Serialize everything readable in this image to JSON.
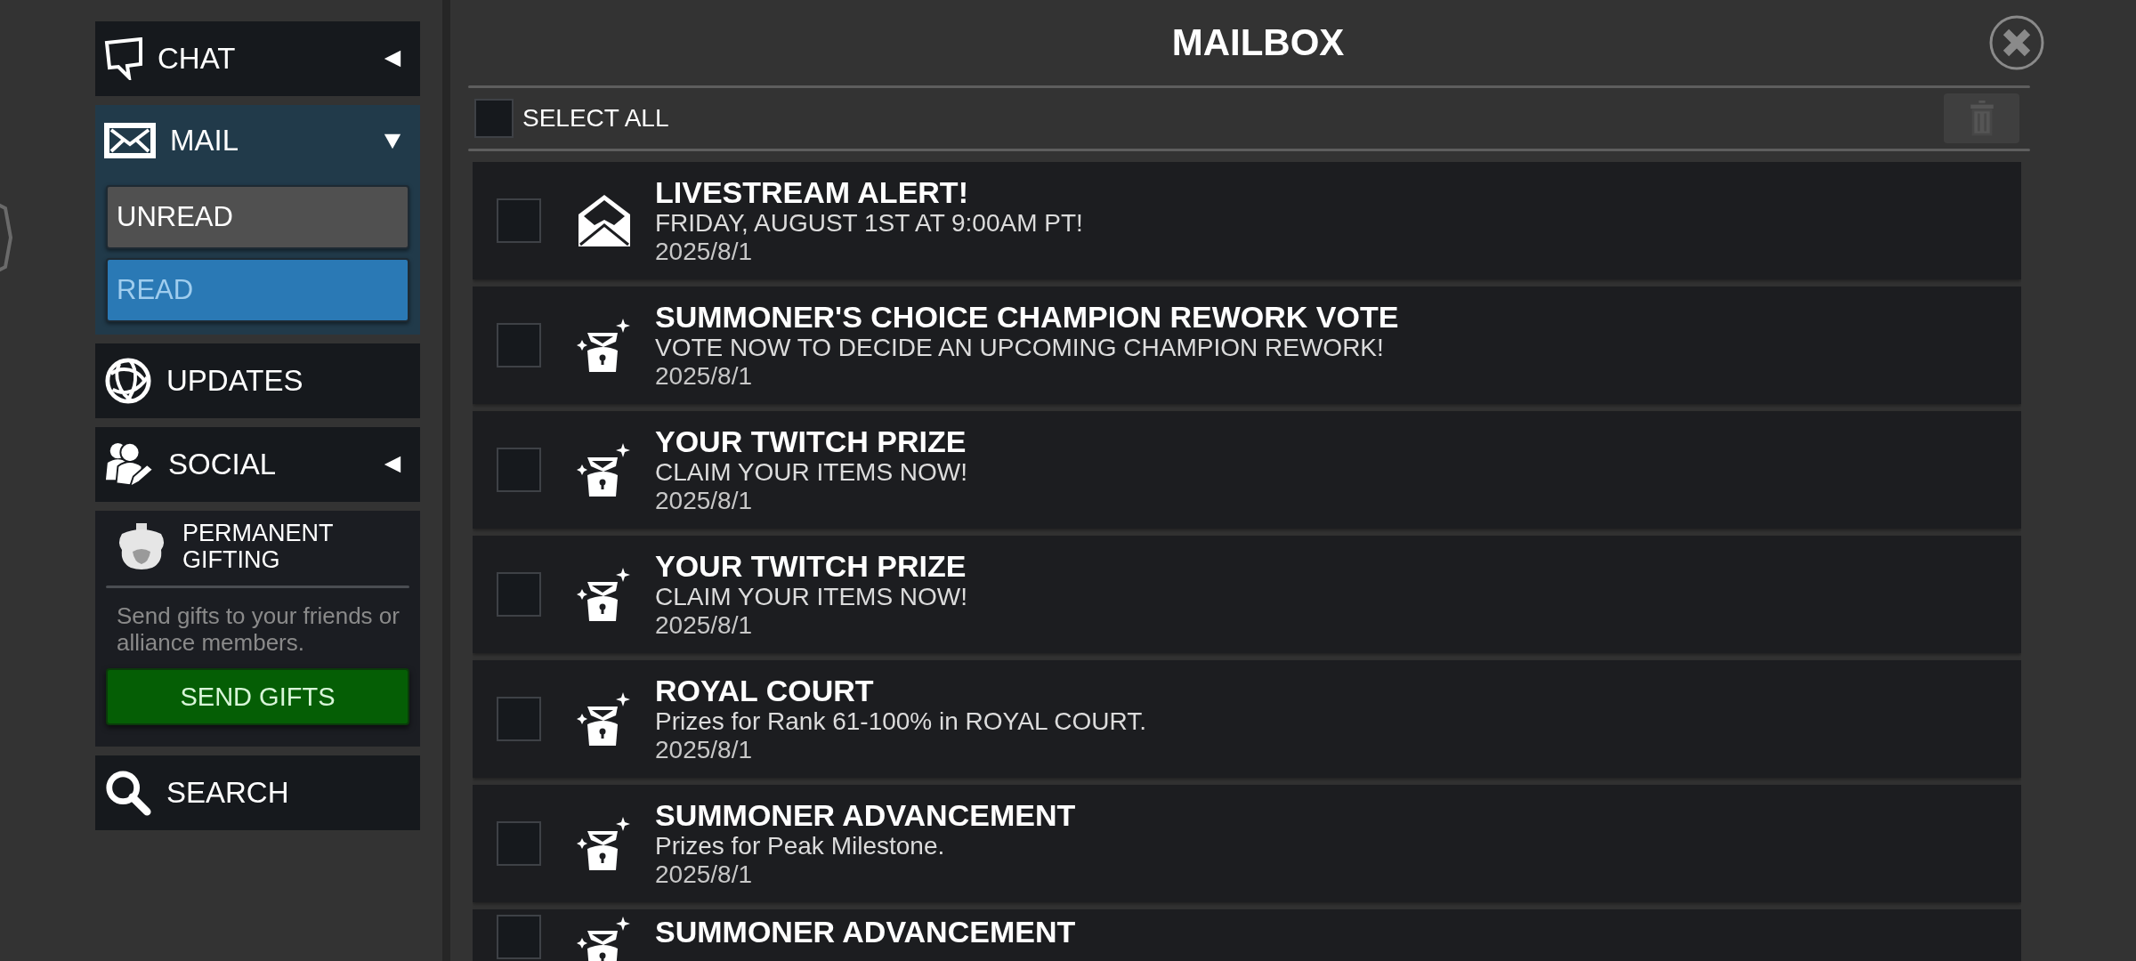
{
  "sidebar": {
    "chat": {
      "label": "CHAT",
      "expanded": false
    },
    "mail": {
      "label": "MAIL",
      "expanded": true,
      "filters": [
        {
          "label": "UNREAD",
          "selected": false
        },
        {
          "label": "READ",
          "selected": true
        }
      ]
    },
    "updates": {
      "label": "UPDATES"
    },
    "social": {
      "label": "SOCIAL",
      "expanded": false
    },
    "gifting": {
      "title": "PERMANENT GIFTING",
      "description": "Send gifts to your friends or alliance members.",
      "button": "SEND GIFTS"
    },
    "search": {
      "label": "SEARCH"
    }
  },
  "mailbox": {
    "title": "MAILBOX",
    "select_all": {
      "label": "SELECT ALL",
      "checked": false
    },
    "messages": [
      {
        "kind": "notice",
        "title": "LIVESTREAM ALERT!",
        "subtitle": "FRIDAY, AUGUST 1ST AT 9:00AM PT!",
        "date": "2025/8/1",
        "checked": false
      },
      {
        "kind": "reward",
        "title": "SUMMONER'S CHOICE CHAMPION REWORK VOTE",
        "subtitle": "VOTE NOW TO DECIDE AN UPCOMING CHAMPION REWORK!",
        "date": "2025/8/1",
        "checked": false
      },
      {
        "kind": "reward",
        "title": "YOUR TWITCH PRIZE",
        "subtitle": "CLAIM YOUR ITEMS NOW!",
        "date": "2025/8/1",
        "checked": false
      },
      {
        "kind": "reward",
        "title": "YOUR TWITCH PRIZE",
        "subtitle": "CLAIM YOUR ITEMS NOW!",
        "date": "2025/8/1",
        "checked": false
      },
      {
        "kind": "reward",
        "title": "ROYAL COURT",
        "subtitle": "Prizes for Rank 61-100% in ROYAL COURT.",
        "date": "2025/8/1",
        "checked": false
      },
      {
        "kind": "reward",
        "title": "SUMMONER ADVANCEMENT",
        "subtitle": "Prizes for Peak Milestone.",
        "date": "2025/8/1",
        "checked": false
      },
      {
        "kind": "reward",
        "title": "SUMMONER ADVANCEMENT",
        "checked": false
      }
    ]
  }
}
